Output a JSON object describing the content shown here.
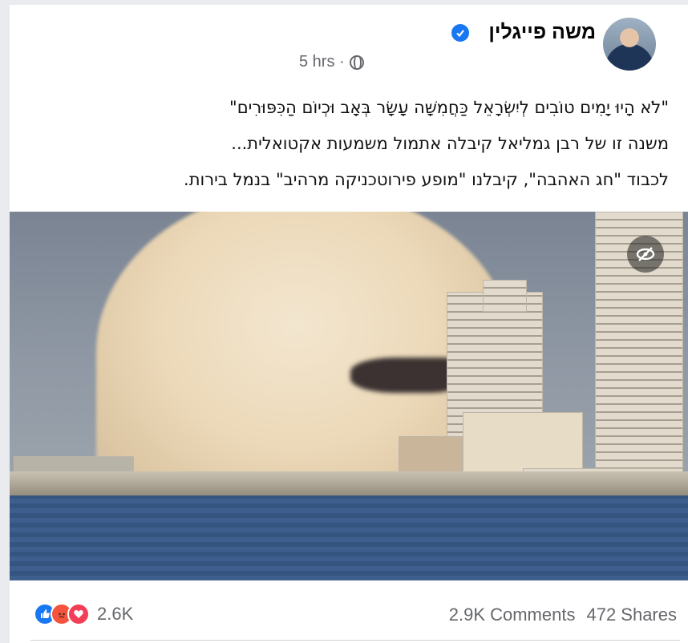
{
  "post": {
    "author": "משה פייגלין",
    "time": "5 hrs ·",
    "lines": [
      "\"לֹא הָיוּ יָמִים טוֹבִים לְיִשְׂרָאֵל כַּחֲמִשָּׁה עָשָׂר בְּאָב וּכְיוֹם הַכִּפּוּרִים\"",
      "משנה זו של רבן גמליאל קיבלה אתמול משמעות אקטואלית...",
      "לכבוד \"חג האהבה\", קיבלנו \"מופע פירוטכניקה מרהיב\" בנמל בירות."
    ]
  },
  "footer": {
    "reaction_count": "2.6K",
    "comments": "2.9K Comments",
    "shares": "472 Shares"
  },
  "icons": {
    "more": "more-icon",
    "verified": "verified-badge-icon",
    "globe": "globe-icon",
    "hide": "eye-off-icon",
    "reactions": [
      "like-icon",
      "angry-icon",
      "love-icon"
    ]
  },
  "colors": {
    "accent": "#1877f2",
    "muted": "#65676b"
  }
}
